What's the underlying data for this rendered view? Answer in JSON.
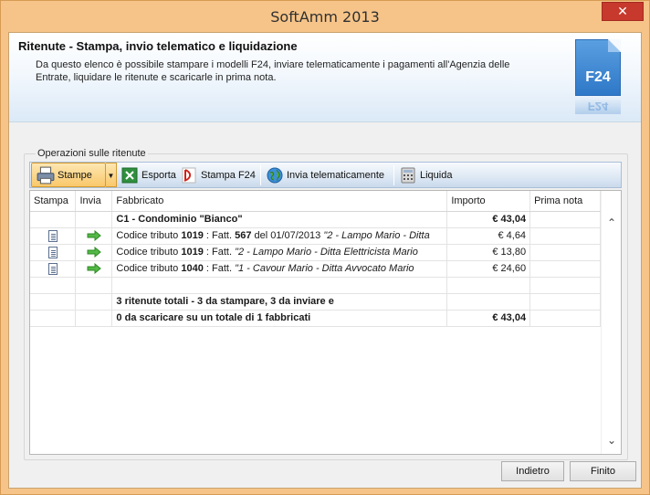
{
  "window": {
    "title": "SoftAmm 2013",
    "close_label": "✕"
  },
  "header": {
    "title": "Ritenute - Stampa, invio telematico e liquidazione",
    "description": "Da questo elenco è possibile stampare i modelli F24, inviare telematicamente i pagamenti all'Agenzia delle Entrate, liquidare le ritenute e scaricarle in prima nota.",
    "icon_label": "F24"
  },
  "group": {
    "label": "Operazioni sulle ritenute"
  },
  "toolbar": {
    "stampe": "Stampe",
    "esporta": "Esporta",
    "stampa_f24": "Stampa F24",
    "invia": "Invia telematicamente",
    "liquida": "Liquida"
  },
  "grid": {
    "headers": {
      "stampa": "Stampa",
      "invia": "Invia",
      "fabbricato": "Fabbricato",
      "importo": "Importo",
      "prima_nota": "Prima nota"
    },
    "group_row": {
      "label": "C1 - Condominio \"Bianco\"",
      "importo": "€ 43,04"
    },
    "rows": [
      {
        "prefix": "Codice tributo ",
        "code": "1019",
        "mid": " : Fatt. ",
        "fatt": "567",
        "extra": " del 01/07/2013 ",
        "desc": "\"2 - Lampo Mario - Ditta",
        "importo": "€ 4,64"
      },
      {
        "prefix": "Codice tributo ",
        "code": "1019",
        "mid": " : Fatt. ",
        "fatt": "",
        "extra": "",
        "desc": "\"2 - Lampo Mario - Ditta Elettricista Mario",
        "importo": "€ 13,80"
      },
      {
        "prefix": "Codice tributo ",
        "code": "1040",
        "mid": " : Fatt. ",
        "fatt": "",
        "extra": "",
        "desc": "\"1 - Cavour Mario - Ditta Avvocato Mario",
        "importo": "€ 24,60"
      }
    ],
    "summary1": "3 ritenute totali - 3 da stampare, 3 da inviare e",
    "summary2": "0 da scaricare su un totale di 1 fabbricati",
    "summary_importo": "€ 43,04"
  },
  "buttons": {
    "indietro": "Indietro",
    "finito": "Finito"
  }
}
